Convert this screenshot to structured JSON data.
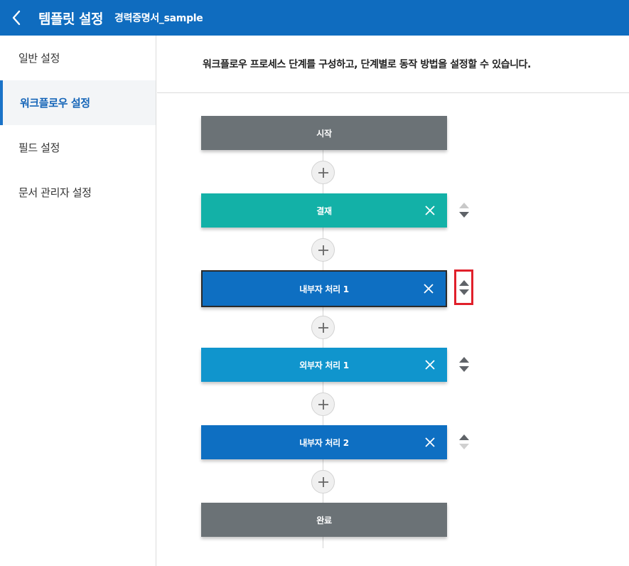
{
  "header": {
    "title": "템플릿 설정",
    "subtitle": "경력증명서_sample",
    "back_icon": "chevron-left-icon",
    "background": "#0f6cbf"
  },
  "sidebar": {
    "items": [
      {
        "label": "일반 설정",
        "active": false
      },
      {
        "label": "워크플로우 설정",
        "active": true
      },
      {
        "label": "필드 설정",
        "active": false
      },
      {
        "label": "문서 관리자 설정",
        "active": false
      }
    ]
  },
  "main": {
    "description": "워크플로우 프로세스 단계를 구성하고, 단계별로 동작 방법을 설정할 수 있습니다."
  },
  "workflow": {
    "steps": [
      {
        "label": "시작",
        "color": "#6b7276",
        "removable": false
      },
      {
        "label": "결재",
        "color": "#13b1a7",
        "removable": true
      },
      {
        "label": "내부자 처리 1",
        "color": "#0e6fc2",
        "removable": true,
        "selected": true
      },
      {
        "label": "외부자 처리 1",
        "color": "#1095cd",
        "removable": true
      },
      {
        "label": "내부자 처리 2",
        "color": "#0e6fc2",
        "removable": true
      },
      {
        "label": "완료",
        "color": "#6b7276",
        "removable": false
      }
    ],
    "icons": {
      "add": "plus-icon",
      "remove": "close-icon",
      "move_up": "arrow-up-icon",
      "move_down": "arrow-down-icon"
    },
    "highlight_color": "#e0202b"
  }
}
